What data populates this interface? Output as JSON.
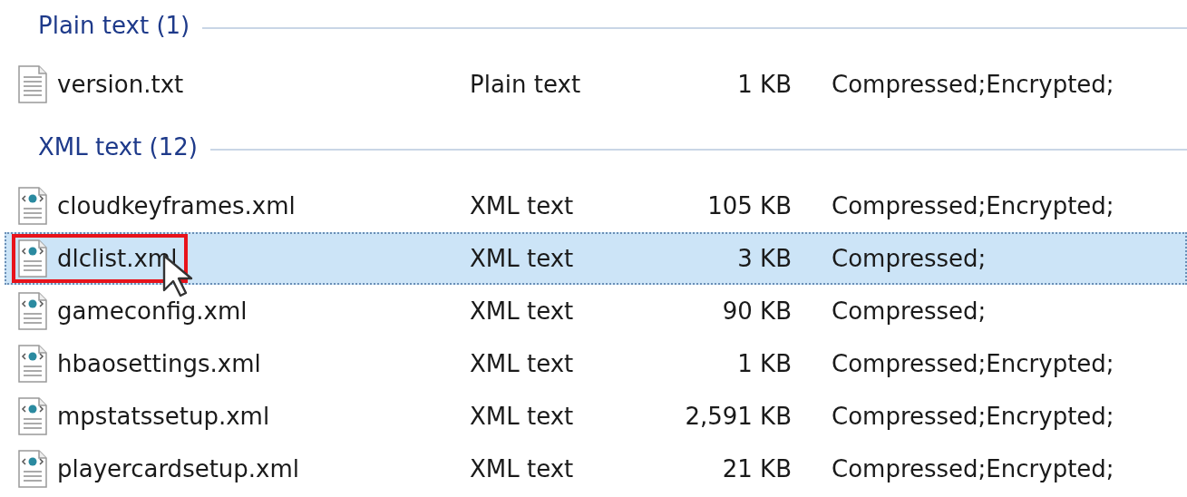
{
  "groups": [
    {
      "title": "Plain text (1)",
      "kind": "text",
      "files": [
        {
          "name": "version.txt",
          "type": "Plain text",
          "size": "1 KB",
          "attributes": "Compressed;Encrypted;",
          "selected": false,
          "outlined": false
        }
      ]
    },
    {
      "title": "XML text (12)",
      "kind": "xml",
      "files": [
        {
          "name": "cloudkeyframes.xml",
          "type": "XML text",
          "size": "105 KB",
          "attributes": "Compressed;Encrypted;",
          "selected": false,
          "outlined": false
        },
        {
          "name": "dlclist.xml",
          "type": "XML text",
          "size": "3 KB",
          "attributes": "Compressed;",
          "selected": true,
          "outlined": true
        },
        {
          "name": "gameconfig.xml",
          "type": "XML text",
          "size": "90 KB",
          "attributes": "Compressed;",
          "selected": false,
          "outlined": false
        },
        {
          "name": "hbaosettings.xml",
          "type": "XML text",
          "size": "1 KB",
          "attributes": "Compressed;Encrypted;",
          "selected": false,
          "outlined": false
        },
        {
          "name": "mpstatssetup.xml",
          "type": "XML text",
          "size": "2,591 KB",
          "attributes": "Compressed;Encrypted;",
          "selected": false,
          "outlined": false
        },
        {
          "name": "playercardsetup.xml",
          "type": "XML text",
          "size": "21 KB",
          "attributes": "Compressed;Encrypted;",
          "selected": false,
          "outlined": false
        }
      ]
    }
  ]
}
